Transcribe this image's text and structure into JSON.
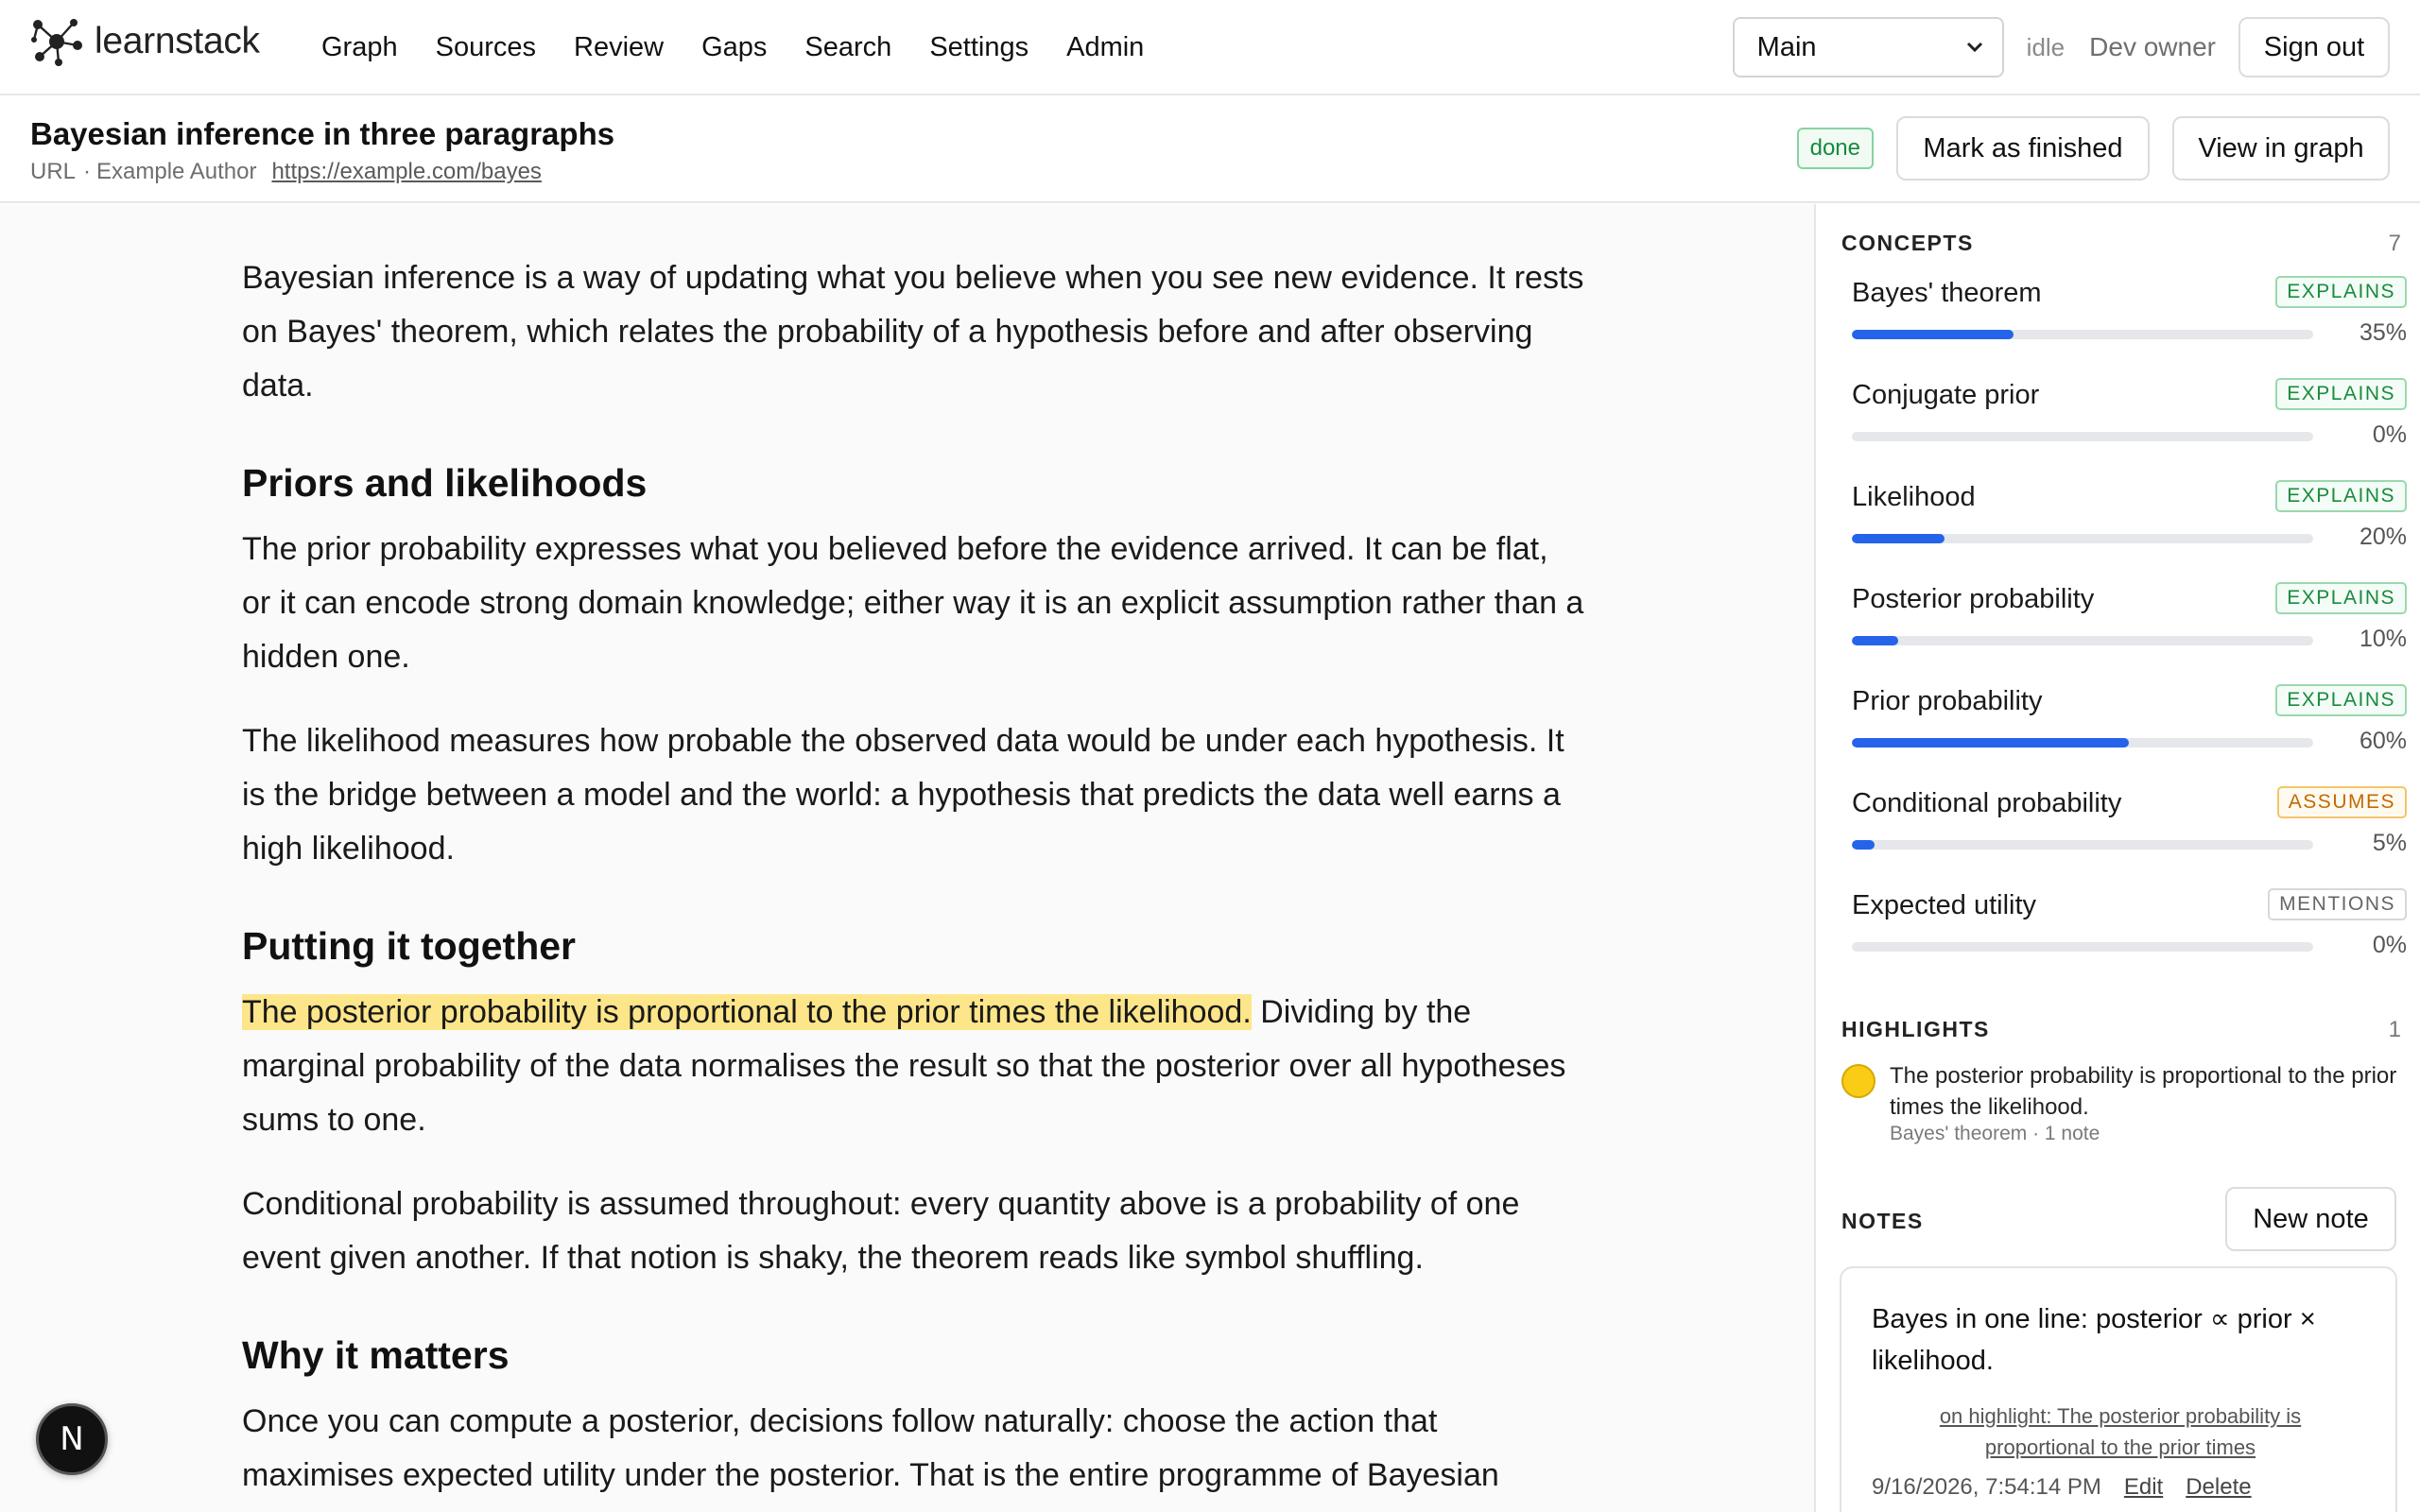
{
  "app": {
    "name": "learnstack",
    "nav": [
      "Graph",
      "Sources",
      "Review",
      "Gaps",
      "Search",
      "Settings",
      "Admin"
    ],
    "workspace_select": "Main",
    "status": "idle",
    "owner": "Dev owner",
    "sign_out": "Sign out"
  },
  "document": {
    "title": "Bayesian inference in three paragraphs",
    "type": "URL",
    "author": "Example Author",
    "url": "https://example.com/bayes",
    "status_badge": "done",
    "mark_finished": "Mark as finished",
    "view_in_graph": "View in graph"
  },
  "article": {
    "p1": "Bayesian inference is a way of updating what you believe when you see new evidence. It rests on Bayes' theorem, which relates the probability of a hypothesis before and after observing data.",
    "h1": "Priors and likelihoods",
    "p2": "The prior probability expresses what you believed before the evidence arrived. It can be flat, or it can encode strong domain knowledge; either way it is an explicit assumption rather than a hidden one.",
    "p3": "The likelihood measures how probable the observed data would be under each hypothesis. It is the bridge between a model and the world: a hypothesis that predicts the data well earns a high likelihood.",
    "h2": "Putting it together",
    "p4_highlight": "The posterior probability is proportional to the prior times the likelihood.",
    "p4_rest": " Dividing by the marginal probability of the data normalises the result so that the posterior over all hypotheses sums to one.",
    "p5": "Conditional probability is assumed throughout: every quantity above is a probability of one event given another. If that notion is shaky, the theorem reads like symbol shuffling.",
    "h3": "Why it matters",
    "p6": "Once you can compute a posterior, decisions follow naturally: choose the action that maximises expected utility under the posterior. That is the entire programme of Bayesian"
  },
  "sidebar": {
    "concepts_label": "CONCEPTS",
    "concepts_count": "7",
    "concepts": [
      {
        "name": "Bayes' theorem",
        "relation": "EXPLAINS",
        "progress": 35,
        "pct": "35%"
      },
      {
        "name": "Conjugate prior",
        "relation": "EXPLAINS",
        "progress": 0,
        "pct": "0%"
      },
      {
        "name": "Likelihood",
        "relation": "EXPLAINS",
        "progress": 20,
        "pct": "20%"
      },
      {
        "name": "Posterior probability",
        "relation": "EXPLAINS",
        "progress": 10,
        "pct": "10%"
      },
      {
        "name": "Prior probability",
        "relation": "EXPLAINS",
        "progress": 60,
        "pct": "60%"
      },
      {
        "name": "Conditional probability",
        "relation": "ASSUMES",
        "progress": 5,
        "pct": "5%"
      },
      {
        "name": "Expected utility",
        "relation": "MENTIONS",
        "progress": 0,
        "pct": "0%"
      }
    ],
    "highlights_label": "HIGHLIGHTS",
    "highlights_count": "1",
    "highlight": {
      "text": "The posterior probability is proportional to the prior times the likelihood.",
      "sub": "Bayes' theorem · 1 note"
    },
    "notes_label": "NOTES",
    "new_note": "New note",
    "note": {
      "body": "Bayes in one line: posterior ∝ prior × likelihood.",
      "link": "on highlight: The posterior probability is proportional to the prior times",
      "timestamp": "9/16/2026, 7:54:14 PM",
      "edit": "Edit",
      "delete": "Delete"
    }
  },
  "overlay": {
    "badge": "N"
  },
  "colors": {
    "accent": "#2563eb",
    "highlight": "#fde68a",
    "done": "#178a3d"
  }
}
